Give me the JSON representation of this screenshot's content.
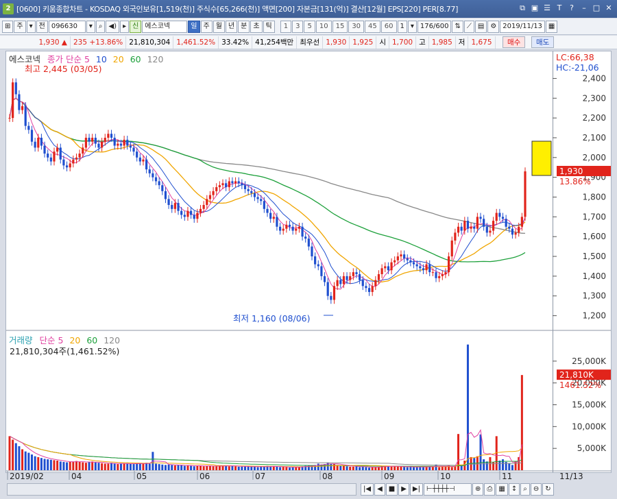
{
  "window": {
    "num": "2",
    "title": "[0600] 키움종합차트 - KOSDAQ 외국인보유[1,519(천)] 주식수[65,266(천)] 액면[200] 자본금[131(억)] 결산[12월] EPS[220] PER[8.77]"
  },
  "toolbar": {
    "mode": "주",
    "sub": "전",
    "code": "096630",
    "credit": "신",
    "name": "에스코넥",
    "periods": [
      "일",
      "주",
      "월",
      "년",
      "분",
      "초",
      "틱"
    ],
    "mins": [
      "1",
      "3",
      "5",
      "10",
      "15",
      "30",
      "45",
      "60"
    ],
    "unit": "1",
    "count": "176/600",
    "date": "2019/11/13"
  },
  "quote": {
    "price": "1,930",
    "arrow": "▲",
    "change": "235",
    "rate": "+13.86%",
    "volume": "21,810,304",
    "vol_rate": "1,461.52%",
    "turnover": "33.42%",
    "amount": "41,254백만",
    "best_label": "최우선",
    "ask": "1,930",
    "bid": "1,925",
    "open_label": "시",
    "open": "1,700",
    "high_label": "고",
    "high": "1,985",
    "low_label": "저",
    "low": "1,675",
    "buy": "매수",
    "sell": "매도"
  },
  "price_panel": {
    "name": "에스코넥",
    "legend_prefix": "종가 단순",
    "ma": [
      "5",
      "10",
      "20",
      "60",
      "120"
    ],
    "high_note": "최고 2,445 (03/05)",
    "low_note": "최저 1,160 (08/06)",
    "lc": "LC:66,38",
    "hc": "HC:-21,06",
    "last": "1,930",
    "last_rate": "13.86%",
    "ticks": [
      "2,400",
      "2,300",
      "2,200",
      "2,100",
      "2,000",
      "1,900",
      "1,800",
      "1,700",
      "1,600",
      "1,500",
      "1,400",
      "1,300",
      "1,200"
    ]
  },
  "volume_panel": {
    "name": "거래량",
    "legend_prefix": "단순",
    "ma": [
      "5",
      "20",
      "60",
      "120"
    ],
    "value": "21,810,304주(1,461.52%)",
    "last": "21,810K",
    "last_rate": "1461.52%",
    "ticks": [
      "25,000K",
      "20,000K",
      "15,000K",
      "10,000K",
      "5,000K"
    ]
  },
  "xaxis": {
    "labels": [
      "2019/02",
      "04",
      "05",
      "06",
      "07",
      "08",
      "09",
      "10",
      "11"
    ],
    "right": "11/13"
  },
  "chart_data": {
    "type": "candlestick",
    "symbol": "096630",
    "ylim": [
      1100,
      2450
    ],
    "ma_periods": [
      5,
      10,
      20,
      60,
      120
    ],
    "last_close": 1930,
    "high": 2445,
    "low": 1160,
    "closes": [
      2200,
      2380,
      2320,
      2240,
      2260,
      2160,
      2140,
      2080,
      2050,
      2100,
      2060,
      2020,
      2000,
      1980,
      2030,
      2050,
      1990,
      1960,
      1950,
      1970,
      1990,
      2000,
      2020,
      2050,
      2100,
      2080,
      2100,
      2070,
      2050,
      2080,
      2100,
      2120,
      2100,
      2060,
      2070,
      2060,
      2090,
      2060,
      2050,
      2030,
      2000,
      1980,
      1990,
      1940,
      1920,
      1900,
      1880,
      1860,
      1830,
      1790,
      1760,
      1740,
      1770,
      1730,
      1710,
      1700,
      1730,
      1710,
      1690,
      1720,
      1740,
      1760,
      1790,
      1810,
      1830,
      1850,
      1860,
      1870,
      1850,
      1880,
      1870,
      1880,
      1870,
      1860,
      1840,
      1830,
      1820,
      1800,
      1790,
      1780,
      1740,
      1720,
      1690,
      1700,
      1650,
      1630,
      1640,
      1660,
      1650,
      1630,
      1640,
      1650,
      1600,
      1590,
      1550,
      1500,
      1460,
      1450,
      1400,
      1370,
      1300,
      1280,
      1350,
      1380,
      1360,
      1400,
      1380,
      1400,
      1420,
      1410,
      1380,
      1350,
      1340,
      1320,
      1350,
      1380,
      1410,
      1440,
      1450,
      1430,
      1470,
      1480,
      1500,
      1510,
      1490,
      1480,
      1470,
      1460,
      1450,
      1440,
      1430,
      1460,
      1420,
      1420,
      1390,
      1400,
      1410,
      1420,
      1500,
      1580,
      1620,
      1650,
      1630,
      1680,
      1640,
      1650,
      1640,
      1700,
      1690,
      1650,
      1620,
      1630,
      1680,
      1720,
      1700,
      1690,
      1650,
      1640,
      1610,
      1620,
      1650,
      1700,
      1930
    ],
    "volume_k": [
      7800,
      7000,
      6200,
      5500,
      4800,
      4300,
      4000,
      3600,
      3200,
      3000,
      2800,
      2600,
      2500,
      2400,
      2300,
      2200,
      2000,
      1900,
      1800,
      1900,
      2000,
      2100,
      1900,
      1800,
      1700,
      1900,
      2000,
      1800,
      1700,
      1600,
      1500,
      1500,
      1700,
      1500,
      1400,
      1500,
      1500,
      1600,
      1500,
      1400,
      1500,
      1600,
      1500,
      1700,
      1500,
      4200,
      1500,
      1400,
      1300,
      1200,
      1300,
      1200,
      1100,
      1200,
      1100,
      1000,
      1100,
      1000,
      900,
      1100,
      1000,
      900,
      1000,
      1000,
      900,
      900,
      1000,
      1000,
      1100,
      900,
      1000,
      900,
      800,
      800,
      900,
      900,
      800,
      800,
      700,
      900,
      800,
      1000,
      800,
      900,
      800,
      700,
      800,
      700,
      600,
      700,
      800,
      700,
      900,
      1000,
      1100,
      1000,
      1200,
      1500,
      1300,
      1400,
      1700,
      1400,
      1500,
      1200,
      1100,
      1100,
      900,
      800,
      800,
      1000,
      700,
      800,
      700,
      600,
      700,
      700,
      800,
      900,
      1000,
      900,
      800,
      900,
      900,
      800,
      800,
      700,
      800,
      700,
      700,
      800,
      700,
      800,
      900,
      800,
      1300,
      700,
      900,
      800,
      1100,
      700,
      900,
      8300,
      1000,
      2200,
      28800,
      3000,
      2800,
      3200,
      8200,
      2500,
      2000,
      3000,
      1800,
      7800,
      2200,
      2500,
      1900,
      1500,
      1200,
      2000,
      3000,
      21810
    ]
  }
}
